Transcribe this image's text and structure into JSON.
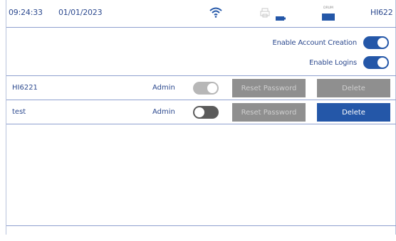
{
  "status_bar": {
    "time": "09:24:33",
    "date": "01/01/2023",
    "drum_label": "DRUM",
    "device_id": "HI622"
  },
  "settings": {
    "account_creation_label": "Enable Account Creation",
    "account_creation_enabled": true,
    "logins_label": "Enable Logins",
    "logins_enabled": true
  },
  "users": [
    {
      "username": "HI6221",
      "role": "Admin",
      "toggle_state": "disabled",
      "reset_label": "Reset Password",
      "delete_label": "Delete",
      "delete_enabled": false
    },
    {
      "username": "test",
      "role": "Admin",
      "toggle_state": "off",
      "reset_label": "Reset Password",
      "delete_label": "Delete",
      "delete_enabled": true
    }
  ],
  "colors": {
    "accent": "#2457a8",
    "text": "#2d4a8f",
    "disabled_button": "#8f8f8f"
  },
  "icons": [
    "wifi-icon",
    "printer-icon",
    "battery-icon",
    "drum-icon"
  ]
}
